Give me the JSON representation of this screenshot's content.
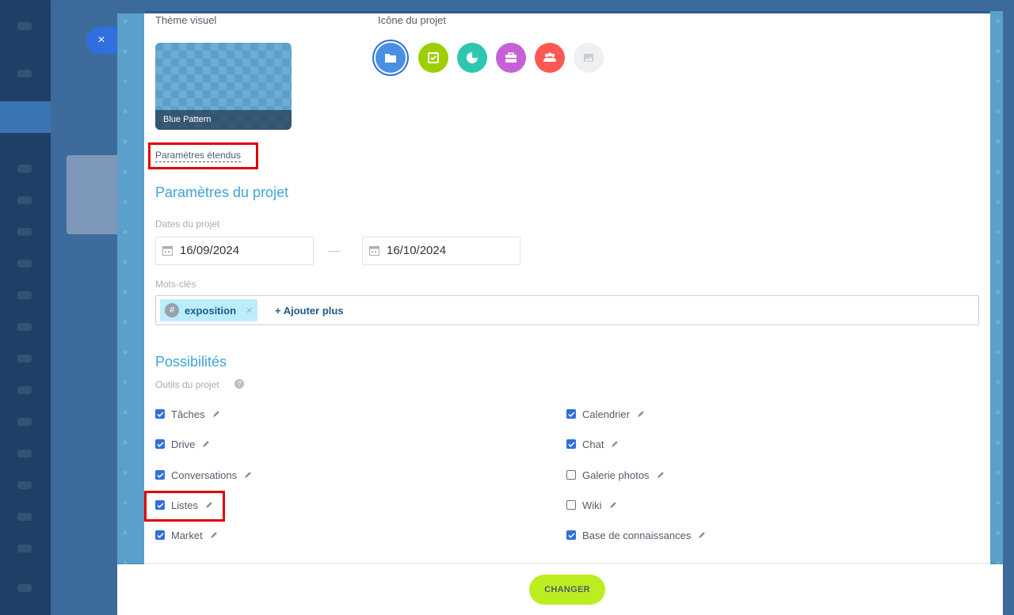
{
  "theme": {
    "section_label": "Thème visuel",
    "selected_name": "Blue Pattern"
  },
  "project_icon": {
    "section_label": "Icône du projet",
    "options": [
      {
        "name": "folder-icon",
        "color": "#4a90e2",
        "selected": true
      },
      {
        "name": "checklist-icon",
        "color": "#9dcf00",
        "selected": false
      },
      {
        "name": "pie-chart-icon",
        "color": "#2fc6b0",
        "selected": false
      },
      {
        "name": "briefcase-icon",
        "color": "#c660d6",
        "selected": false
      },
      {
        "name": "group-icon",
        "color": "#ff5752",
        "selected": false
      },
      {
        "name": "image-icon",
        "color": "#eef0f2",
        "selected": false
      }
    ]
  },
  "extended_settings_link": "Paramètres étendus",
  "project_settings": {
    "title": "Paramètres du projet",
    "dates_label": "Dates du projet",
    "start_date": "16/09/2024",
    "end_date": "16/10/2024",
    "keywords_label": "Mots-clés",
    "tags": [
      "exposition"
    ],
    "add_more_label": "+ Ajouter plus"
  },
  "features": {
    "title": "Possibilités",
    "tools_label": "Outils du projet",
    "help_icon": "?",
    "left": [
      {
        "label": "Tâches",
        "checked": true
      },
      {
        "label": "Drive",
        "checked": true
      },
      {
        "label": "Conversations",
        "checked": true
      },
      {
        "label": "Listes",
        "checked": true
      },
      {
        "label": "Market",
        "checked": true
      }
    ],
    "right": [
      {
        "label": "Calendrier",
        "checked": true
      },
      {
        "label": "Chat",
        "checked": true
      },
      {
        "label": "Galerie photos",
        "checked": false
      },
      {
        "label": "Wiki",
        "checked": false
      },
      {
        "label": "Base de connaissances",
        "checked": true
      }
    ]
  },
  "footer": {
    "change_button": "CHANGER"
  },
  "close_symbol": "×",
  "colors": {
    "accent_blue": "#2f6fe0",
    "section_title": "#3fa3d8",
    "highlight_red": "#e00000",
    "primary_button": "#bbed21"
  }
}
